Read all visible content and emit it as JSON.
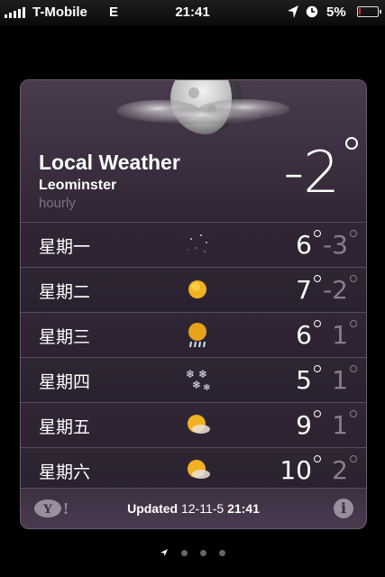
{
  "status_bar": {
    "carrier": "T-Mobile",
    "network": "E",
    "time": "21:41",
    "battery_percent": "5%",
    "battery_level": 0.05,
    "icons": [
      "signal-bars-icon",
      "location-arrow-icon",
      "alarm-clock-icon",
      "battery-icon"
    ]
  },
  "weather": {
    "title": "Local Weather",
    "city": "Leominster",
    "mode": "hourly",
    "current_temp": "-2",
    "current_condition_icon": "moon-behind-cloud-icon",
    "forecast": [
      {
        "day": "星期一",
        "icon": "clear-night-stars-icon",
        "high": "6",
        "low": "-3"
      },
      {
        "day": "星期二",
        "icon": "sunny-icon",
        "high": "7",
        "low": "-2"
      },
      {
        "day": "星期三",
        "icon": "sun-rain-icon",
        "high": "6",
        "low": "1"
      },
      {
        "day": "星期四",
        "icon": "snow-icon",
        "high": "5",
        "low": "1"
      },
      {
        "day": "星期五",
        "icon": "partly-cloudy-icon",
        "high": "9",
        "low": "1"
      },
      {
        "day": "星期六",
        "icon": "partly-cloudy-icon",
        "high": "10",
        "low": "2"
      }
    ]
  },
  "footer": {
    "logo": "Y!",
    "updated_label": "Updated",
    "updated_date": "12-11-5",
    "updated_time": "21:41",
    "info_label": "i"
  },
  "pager": {
    "pages": 4,
    "current": 0
  },
  "colors": {
    "accent_text": "#ffffff",
    "low_temp": "#8a7c8e",
    "card_bg": "#2b2130",
    "battery_low": "#e0242a"
  }
}
